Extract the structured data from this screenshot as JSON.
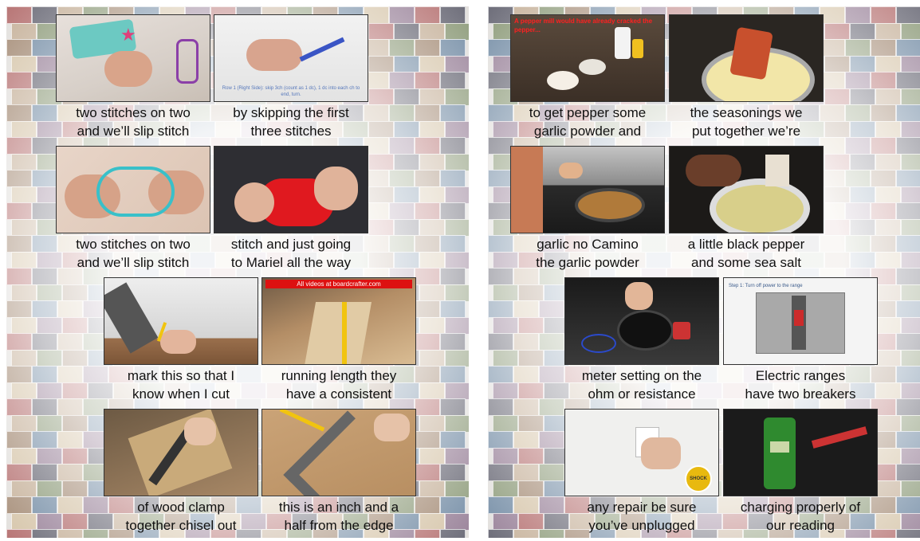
{
  "colors": {
    "banner_red": "#dd1111",
    "tile_palette": [
      "#8a6a4e",
      "#4a6a8a",
      "#b59a7c",
      "#6b7d52",
      "#a04848",
      "#3d3d4d",
      "#c9b38f",
      "#7a5c7a"
    ]
  },
  "panels": [
    {
      "cards": [
        {
          "caption": [
            "two stitches on two",
            "and we’ll slip stitch"
          ],
          "scene": "crochet-pink"
        },
        {
          "caption": [
            "by skipping the first",
            "three stitches"
          ],
          "scene": "crochet-hook",
          "overlay": "Row 1 (Right Side): skip 3ch (count as 1 dc), 1 dc into each ch to end, turn."
        },
        {
          "caption": [
            "two stitches on two",
            "and we’ll slip stitch"
          ],
          "scene": "crochet-teal"
        },
        {
          "caption": [
            "stitch and just going",
            "to Mariel all the way"
          ],
          "scene": "crochet-red"
        },
        {
          "caption": [
            "mark this so that I",
            "know when I cut"
          ],
          "scene": "wood-mark"
        },
        {
          "caption": [
            "running length they",
            "have a consistent"
          ],
          "scene": "wood-board",
          "banner": "All videos at boardcrafter.com"
        },
        {
          "caption": [
            "of wood clamp",
            "together chisel out"
          ],
          "scene": "wood-square"
        },
        {
          "caption": [
            "this is an inch and a",
            "half from the edge"
          ],
          "scene": "wood-speed"
        }
      ]
    },
    {
      "cards": [
        {
          "caption": [
            "to get pepper some",
            "garlic powder and"
          ],
          "scene": "kitchen-counter",
          "banner": "A pepper mill would have already cracked the pepper..."
        },
        {
          "caption": [
            "the seasonings we",
            "put together we’re"
          ],
          "scene": "kitchen-bowl"
        },
        {
          "caption": [
            "garlic no Camino",
            "the garlic powder"
          ],
          "scene": "kitchen-stove"
        },
        {
          "caption": [
            "a little black pepper",
            "and some sea salt"
          ],
          "scene": "kitchen-pot"
        },
        {
          "caption": [
            "meter setting on the",
            "ohm or resistance"
          ],
          "scene": "speaker-meter"
        },
        {
          "caption": [
            "Electric ranges",
            "have two breakers"
          ],
          "scene": "breaker-panel",
          "overlay": "Step 1:  Turn off power to the range"
        },
        {
          "caption": [
            "any repair be sure",
            "you’ve unplugged"
          ],
          "scene": "outlet",
          "badge": "SHOCK"
        },
        {
          "caption": [
            "charging properly of",
            "our reading"
          ],
          "scene": "clamp-meter"
        }
      ]
    }
  ]
}
